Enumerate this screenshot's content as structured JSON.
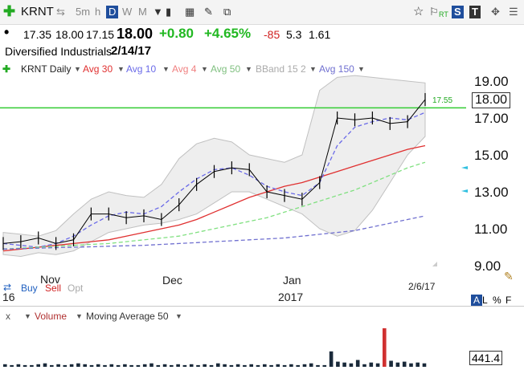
{
  "toolbar": {
    "symbol": "KRNT",
    "timeframes": [
      "5m",
      "h",
      "D",
      "W",
      "M"
    ],
    "active_timeframe": "D",
    "right_labels": [
      "RT",
      "S",
      "T"
    ],
    "icons": [
      "add-icon",
      "sync-icon",
      "dropdown-icon",
      "grid-icon",
      "pencil-icon",
      "layers-icon",
      "star-icon",
      "flag-icon",
      "move-icon",
      "menu-icon"
    ]
  },
  "quote": {
    "open": "17.35",
    "high": "18.00",
    "low": "17.15",
    "close": "18.00",
    "change": "+0.80",
    "change_pct": "+4.65%",
    "rank": "-85",
    "v1": "5.3",
    "v2": "1.61"
  },
  "company": {
    "name": "Diversified Industrials",
    "date": "2/14/17"
  },
  "legend": {
    "symbol_label": "KRNT Daily",
    "items": [
      {
        "label": "Avg 30",
        "color": "#e03030"
      },
      {
        "label": "Avg 10",
        "color": "#6a6ae8"
      },
      {
        "label": "Avg 4",
        "color": "#f08080"
      },
      {
        "label": "Avg 50",
        "color": "#80e080"
      },
      {
        "label": "BBand 15 2",
        "color": "#b0b0b0"
      },
      {
        "label": "Avg 150",
        "color": "#7070d0"
      }
    ]
  },
  "chart_data": {
    "type": "line",
    "title": "KRNT Daily",
    "x_tick_labels": [
      "Nov",
      "Dec",
      "Jan",
      "2017",
      "2/6/17",
      "16"
    ],
    "y_ticks": [
      "19.00",
      "17.00",
      "15.00",
      "13.00",
      "11.00",
      "9.00"
    ],
    "ylim": [
      9,
      20
    ],
    "last_price": "18.00",
    "horizontal_line": {
      "value": 17.55,
      "label": "17.55",
      "color": "#33cc33"
    },
    "series": [
      {
        "name": "Avg 30",
        "color": "#e03030",
        "values": [
          9.8,
          9.9,
          10.0,
          10.1,
          10.2,
          10.3,
          10.4,
          10.6,
          10.8,
          11.0,
          11.2,
          11.5,
          11.9,
          12.3,
          12.7,
          13.0,
          13.3,
          13.5,
          13.8,
          14.1,
          14.4,
          14.7,
          15.0,
          15.3,
          15.5
        ]
      },
      {
        "name": "Avg 10",
        "color": "#6a6ae8",
        "values": [
          10.2,
          10.1,
          10.0,
          10.2,
          10.6,
          11.2,
          11.7,
          11.9,
          11.8,
          12.2,
          13.0,
          13.7,
          14.2,
          14.3,
          13.9,
          13.3,
          13.0,
          12.8,
          13.5,
          15.5,
          16.5,
          16.8,
          17.0,
          16.9,
          17.3
        ]
      },
      {
        "name": "Avg 50",
        "color": "#80e080",
        "values": [
          9.9,
          9.95,
          10.0,
          10.05,
          10.1,
          10.15,
          10.2,
          10.3,
          10.4,
          10.5,
          10.6,
          10.8,
          11.0,
          11.2,
          11.4,
          11.6,
          11.9,
          12.2,
          12.5,
          12.8,
          13.1,
          13.5,
          13.9,
          14.3,
          14.6
        ]
      },
      {
        "name": "Avg 150",
        "color": "#7070d0",
        "values": [
          9.9,
          9.92,
          9.95,
          9.98,
          10.0,
          10.02,
          10.05,
          10.08,
          10.1,
          10.15,
          10.2,
          10.25,
          10.3,
          10.35,
          10.4,
          10.45,
          10.5,
          10.6,
          10.7,
          10.8,
          10.9,
          11.1,
          11.3,
          11.5,
          11.7
        ]
      },
      {
        "name": "Price",
        "color": "#000000",
        "values": [
          10.2,
          10.3,
          10.5,
          10.2,
          10.4,
          11.8,
          11.8,
          11.6,
          11.7,
          11.5,
          12.3,
          13.4,
          14.1,
          14.3,
          14.2,
          13.0,
          12.8,
          12.6,
          13.5,
          17.0,
          16.9,
          17.0,
          16.7,
          16.8,
          18.0
        ]
      }
    ],
    "bollinger_upper": [
      10.8,
      10.7,
      10.6,
      10.9,
      11.8,
      12.6,
      13.0,
      12.8,
      12.7,
      13.4,
      14.8,
      15.6,
      15.9,
      15.7,
      15.0,
      14.8,
      14.6,
      15.0,
      18.5,
      19.2,
      19.3,
      19.2,
      19.1,
      19.0,
      18.9
    ],
    "bollinger_lower": [
      9.6,
      9.5,
      9.7,
      9.6,
      9.8,
      10.3,
      10.8,
      11.0,
      11.2,
      11.3,
      11.5,
      11.8,
      12.4,
      13.0,
      13.0,
      12.6,
      12.2,
      11.8,
      11.0,
      10.6,
      10.9,
      12.0,
      13.5,
      15.0,
      16.0
    ]
  },
  "volume": {
    "label": "Volume",
    "ma_label": "Moving Average 50",
    "last_value": "441.4",
    "values": [
      3,
      2,
      3,
      2,
      2,
      3,
      4,
      2,
      3,
      2,
      3,
      4,
      3,
      2,
      3,
      2,
      3,
      2,
      3,
      2,
      2,
      3,
      4,
      2,
      3,
      2,
      3,
      2,
      3,
      2,
      3,
      2,
      4,
      3,
      2,
      3,
      2,
      3,
      2,
      3,
      2,
      3,
      2,
      3,
      2,
      3,
      4,
      2,
      2,
      18,
      6,
      5,
      4,
      8,
      3,
      5,
      4,
      45,
      7,
      5,
      6,
      4,
      5,
      4
    ],
    "highlight_index": 57
  },
  "buy_sell": {
    "buy": "Buy",
    "sell": "Sell",
    "opt": "Opt"
  },
  "right_panel": {
    "letters": [
      "A",
      "L",
      "%",
      "F"
    ]
  }
}
